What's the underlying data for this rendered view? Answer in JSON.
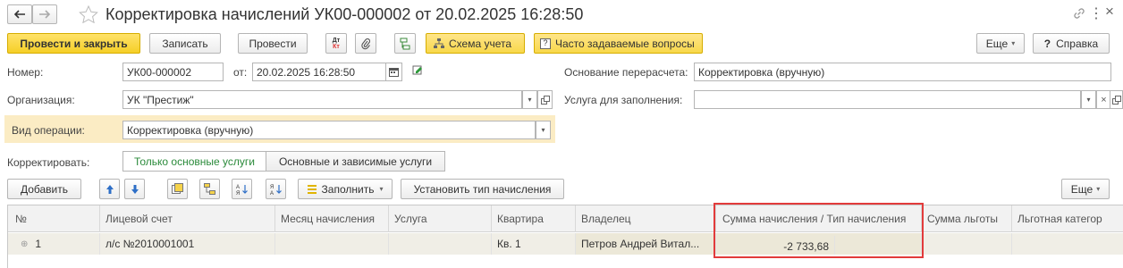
{
  "window": {
    "title": "Корректировка начислений УК00-000002 от 20.02.2025 16:28:50",
    "more_glyph": "⋮",
    "close_glyph": "×"
  },
  "toolbar": {
    "post_close": "Провести и закрыть",
    "save": "Записать",
    "post": "Провести",
    "dtkt_top": "Дт",
    "dtkt_bottom": "Кт",
    "scheme": "Схема учета",
    "faq": "Часто задаваемые вопросы",
    "more": "Еще",
    "help": "Справка",
    "help_q": "?"
  },
  "form": {
    "number_label": "Номер:",
    "number_value": "УК00-000002",
    "from_label": "от:",
    "date_value": "20.02.2025 16:28:50",
    "basis_label": "Основание перерасчета:",
    "basis_value": "Корректировка (вручную)",
    "org_label": "Организация:",
    "org_value": "УК \"Престиж\"",
    "service_label": "Услуга для заполнения:",
    "service_value": "",
    "optype_label": "Вид операции:",
    "optype_value": "Корректировка (вручную)",
    "correct_label": "Корректировать:",
    "toggle_main": "Только основные услуги",
    "toggle_deps": "Основные и зависимые услуги"
  },
  "table_toolbar": {
    "add": "Добавить",
    "fill": "Заполнить",
    "set_type": "Установить тип начисления",
    "more": "Еще"
  },
  "table": {
    "columns": [
      "№",
      "Лицевой счет",
      "Месяц начисления",
      "Услуга",
      "Квартира",
      "Владелец",
      "Сумма начисления / Тип начисления",
      "Сумма льготы",
      "Льготная категор"
    ],
    "rows": [
      {
        "num": "1",
        "account": "л/с №2010001001",
        "month": "",
        "service": "",
        "apartment": "Кв. 1",
        "owner": "Петров Андрей Витал...",
        "amount": "-2 733,68",
        "benefit": "",
        "category": ""
      }
    ]
  },
  "colors": {
    "accent_yellow": "#f5cf27",
    "highlight_red": "#e23b3b",
    "green_toggle": "#2a8a3a"
  }
}
